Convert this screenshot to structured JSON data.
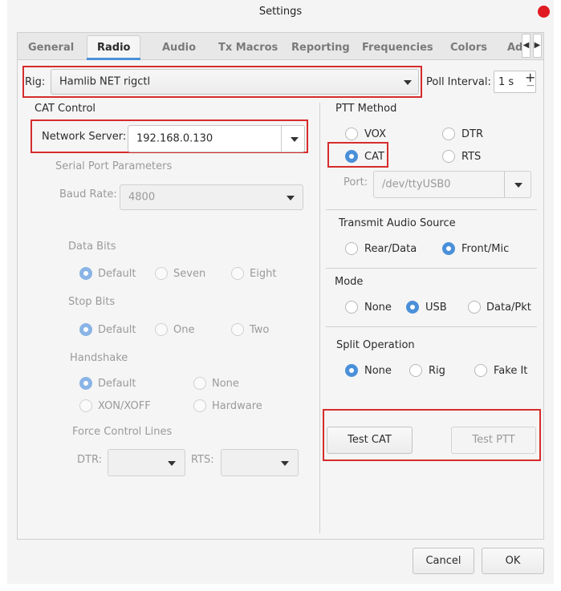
{
  "window": {
    "title": "Settings"
  },
  "tabs": [
    "General",
    "Radio",
    "Audio",
    "Tx Macros",
    "Reporting",
    "Frequencies",
    "Colors",
    "Ad"
  ],
  "tab_scroll": {
    "left": "◀",
    "right": "▶"
  },
  "rig": {
    "label": "Rig:",
    "value": "Hamlib NET rigctl"
  },
  "poll": {
    "label": "Poll Interval:",
    "value": "1 s",
    "plus": "+",
    "minus": "−"
  },
  "cat": {
    "title": "CAT Control",
    "network_label": "Network Server:",
    "network_value": "192.168.0.130",
    "serial_title": "Serial Port Parameters",
    "baud_label": "Baud Rate:",
    "baud_value": "4800",
    "data_bits": {
      "title": "Data Bits",
      "options": [
        "Default",
        "Seven",
        "Eight"
      ]
    },
    "stop_bits": {
      "title": "Stop Bits",
      "options": [
        "Default",
        "One",
        "Two"
      ]
    },
    "handshake": {
      "title": "Handshake",
      "options": [
        "Default",
        "None",
        "XON/XOFF",
        "Hardware"
      ]
    },
    "force": {
      "title": "Force Control Lines",
      "dtr_label": "DTR:",
      "rts_label": "RTS:"
    }
  },
  "ptt": {
    "title": "PTT Method",
    "options": [
      "VOX",
      "DTR",
      "CAT",
      "RTS"
    ],
    "selected": "CAT",
    "port_label": "Port:",
    "port_value": "/dev/ttyUSB0"
  },
  "audio_source": {
    "title": "Transmit Audio Source",
    "options": [
      "Rear/Data",
      "Front/Mic"
    ],
    "selected": "Front/Mic"
  },
  "mode": {
    "title": "Mode",
    "options": [
      "None",
      "USB",
      "Data/Pkt"
    ],
    "selected": "USB"
  },
  "split": {
    "title": "Split Operation",
    "options": [
      "None",
      "Rig",
      "Fake It"
    ],
    "selected": "None"
  },
  "buttons": {
    "test_cat": "Test CAT",
    "test_ptt": "Test PTT",
    "cancel": "Cancel",
    "ok": "OK"
  },
  "colors": {
    "accent": "#4a90d9",
    "highlight": "#d62c2c",
    "close": "#e01b24"
  }
}
